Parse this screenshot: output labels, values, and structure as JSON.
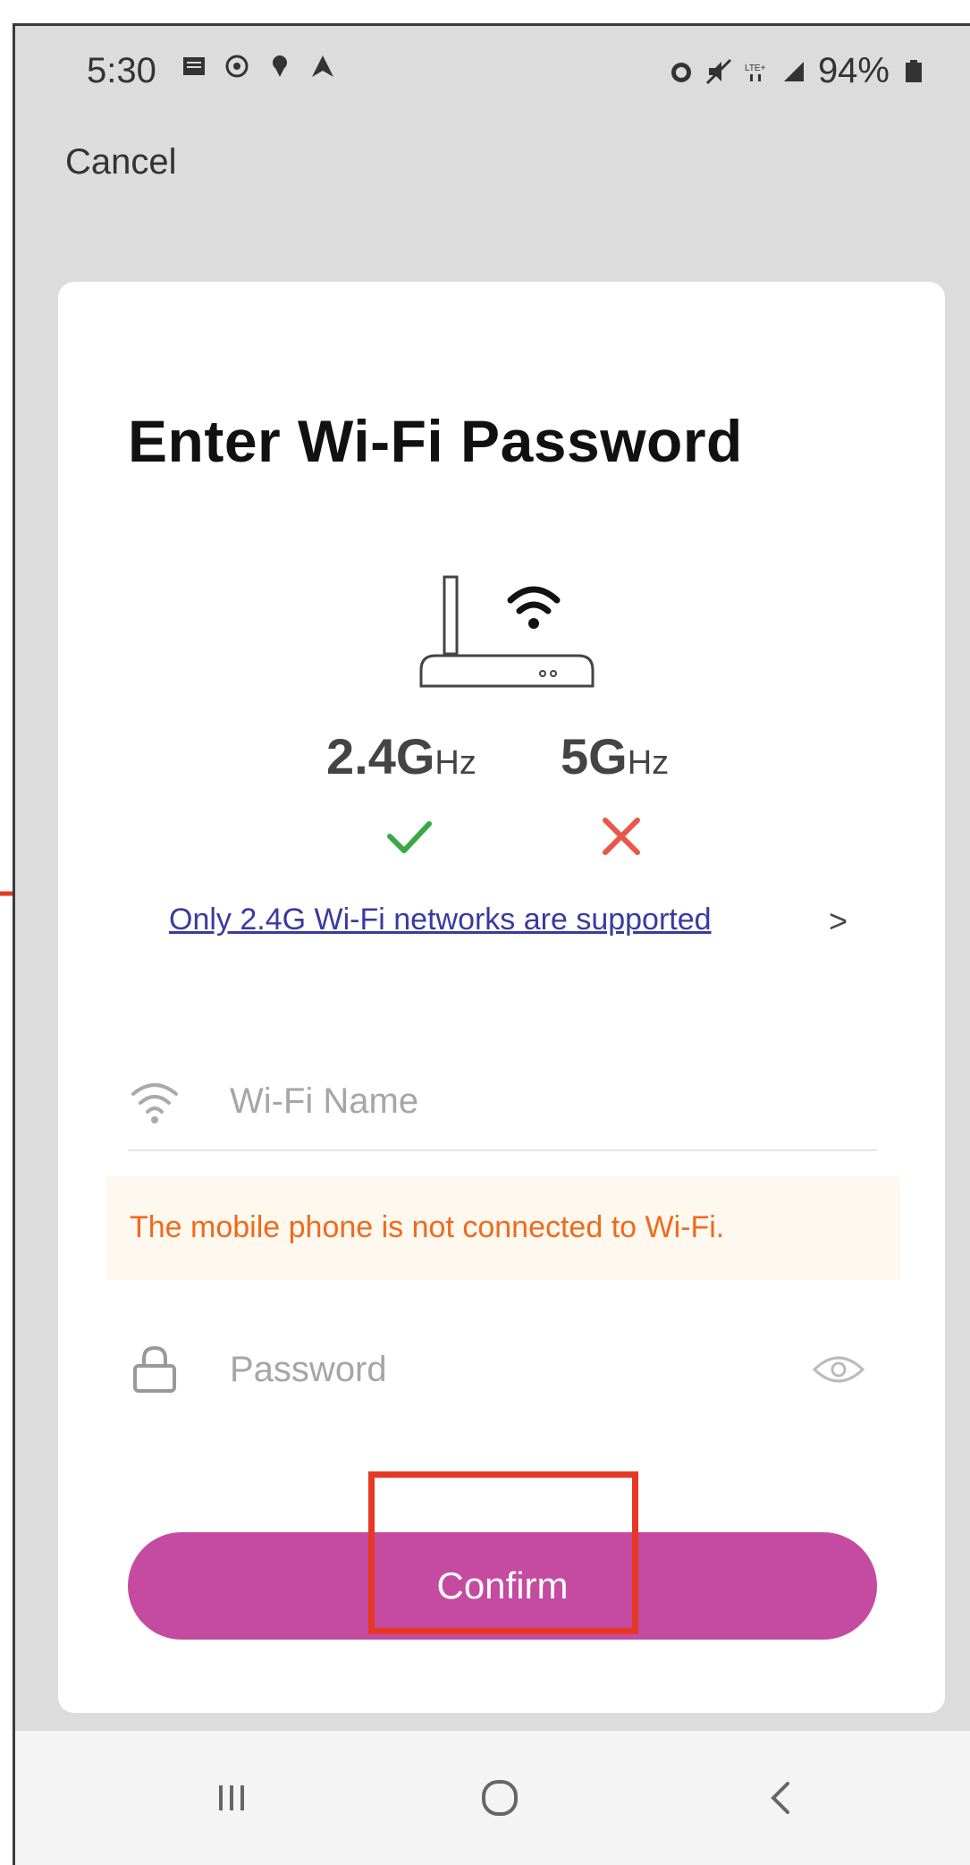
{
  "status_bar": {
    "time": "5:30",
    "left_icons": [
      "message-icon",
      "whatsapp-icon",
      "location-pin-icon",
      "navigation-icon"
    ],
    "right_icons": [
      "alarm-icon",
      "mute-icon",
      "lte-icon",
      "signal-icon"
    ],
    "battery": "94%"
  },
  "header": {
    "cancel_label": "Cancel"
  },
  "card": {
    "title": "Enter Wi-Fi Password",
    "band_24": {
      "value": "2.4G",
      "unit": "Hz"
    },
    "band_5": {
      "value": "5G",
      "unit": "Hz"
    },
    "note_link": "Only 2.4G Wi-Fi networks are supported",
    "note_chevron": ">",
    "wifi_field": {
      "placeholder": "Wi-Fi Name",
      "value": ""
    },
    "warning": "The mobile phone is not connected to Wi-Fi.",
    "password_field": {
      "placeholder": "Password",
      "value": ""
    },
    "confirm_label": "Confirm"
  },
  "colors": {
    "accent": "#c44ba0",
    "warning_text": "#f06a1c",
    "warning_bg": "#fff8ee",
    "link": "#3a3aa0",
    "ok": "#3aa846",
    "no": "#e8574a",
    "annotation": "#e53926"
  }
}
